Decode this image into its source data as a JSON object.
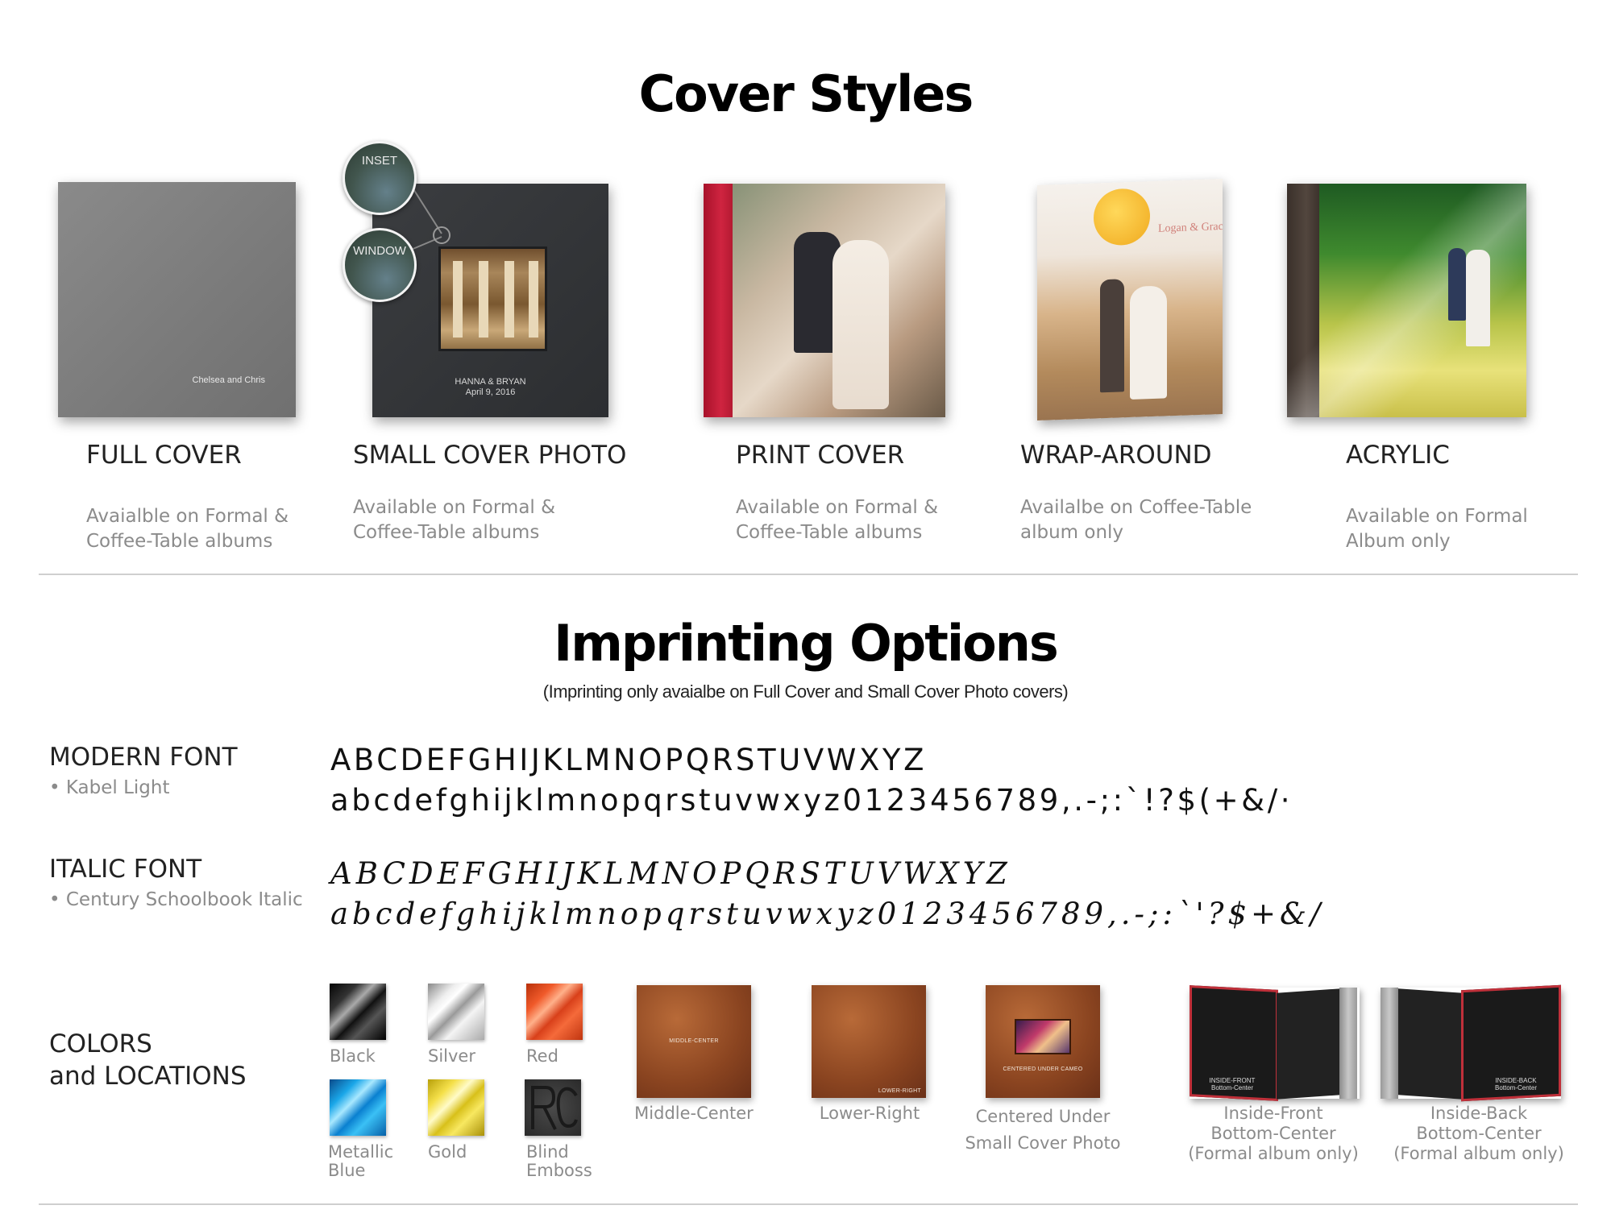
{
  "cover_styles": {
    "title": "Cover Styles",
    "items": [
      {
        "name": "FULL COVER",
        "desc": [
          "Avaialble on Formal &",
          "Coffee-Table albums"
        ],
        "imprint": "Chelsea and Chris"
      },
      {
        "name": "SMALL COVER PHOTO",
        "desc": [
          "Available on Formal &",
          "Coffee-Table albums"
        ],
        "imprint_line1": "HANNA & BRYAN",
        "imprint_line2": "April 9, 2016",
        "callout_inset": "INSET",
        "callout_window": "WINDOW"
      },
      {
        "name": "PRINT COVER",
        "desc": [
          "Available on Formal &",
          "Coffee-Table albums"
        ]
      },
      {
        "name": "WRAP-AROUND",
        "desc": [
          "Availalbe on Coffee-Table",
          "album only"
        ],
        "imprint": "Logan & Grace"
      },
      {
        "name": "ACRYLIC",
        "desc": [
          "Available on Formal",
          "Album only"
        ]
      }
    ]
  },
  "imprinting": {
    "title": "Imprinting Options",
    "note": "(Imprinting only avaialbe on Full Cover and Small Cover Photo covers)",
    "fonts": [
      {
        "label": "MODERN FONT",
        "sub": "• Kabel Light",
        "upper": "ABCDEFGHIJKLMNOPQRSTUVWXYZ",
        "lower": "abcdefghijklmnopqrstuvwxyz0123456789,.-;:`!?$(+&/·"
      },
      {
        "label": "ITALIC FONT",
        "sub": "• Century Schoolbook Italic",
        "upper": "ABCDEFGHIJKLMNOPQRSTUVWXYZ",
        "lower": "abcdefghijklmnopqrstuvwxyz0123456789,.-;:`'?$+&/"
      }
    ],
    "colors_label": [
      "COLORS",
      "and LOCATIONS"
    ],
    "colors": [
      {
        "name": [
          "Black"
        ],
        "hex": "#111111"
      },
      {
        "name": [
          "Silver"
        ],
        "hex": "#c8c8c8"
      },
      {
        "name": [
          "Red"
        ],
        "hex": "#e04a1e"
      },
      {
        "name": [
          "Metallic",
          "Blue"
        ],
        "hex": "#1aa6e8"
      },
      {
        "name": [
          "Gold"
        ],
        "hex": "#e8d21a"
      },
      {
        "name": [
          "Blind",
          "Emboss"
        ],
        "hex": "#3a3a3a"
      }
    ],
    "locations": [
      {
        "label": [
          "Middle-Center"
        ],
        "imprint": "MIDDLE-CENTER"
      },
      {
        "label": [
          "Lower-Right"
        ],
        "imprint": "LOWER-RIGHT"
      },
      {
        "label": [
          "Centered Under",
          "Small Cover Photo"
        ],
        "imprint": "CENTERED UNDER CAMEO"
      },
      {
        "label": [
          "Inside-Front",
          "Bottom-Center",
          "(Formal album only)"
        ],
        "imprint_line1": "INSIDE-FRONT",
        "imprint_line2": "Bottom-Center"
      },
      {
        "label": [
          "Inside-Back",
          "Bottom-Center",
          "(Formal album only)"
        ],
        "imprint_line1": "INSIDE-BACK",
        "imprint_line2": "Bottom-Center"
      }
    ]
  }
}
